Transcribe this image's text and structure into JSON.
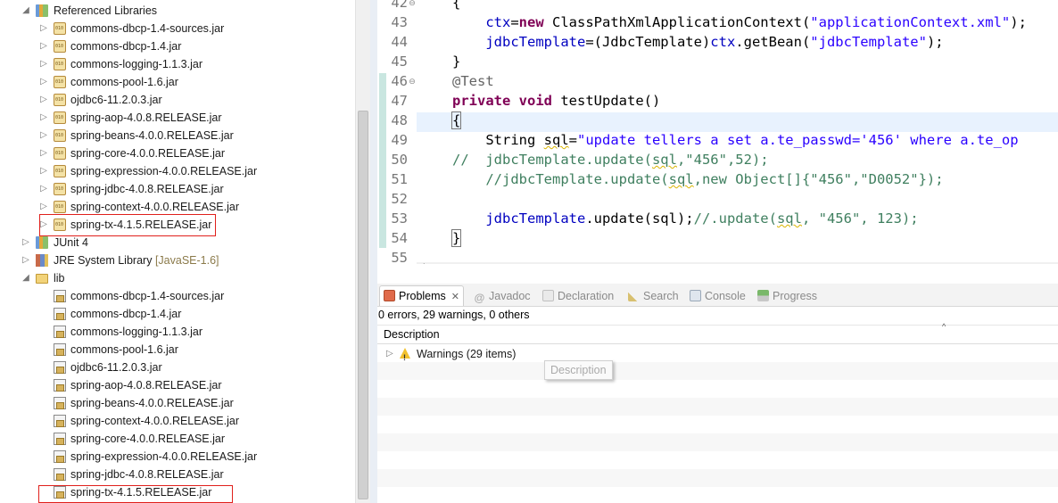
{
  "tree": {
    "referenced_libraries": {
      "label": "Referenced Libraries",
      "items": [
        "commons-dbcp-1.4-sources.jar",
        "commons-dbcp-1.4.jar",
        "commons-logging-1.1.3.jar",
        "commons-pool-1.6.jar",
        "ojdbc6-11.2.0.3.jar",
        "spring-aop-4.0.8.RELEASE.jar",
        "spring-beans-4.0.0.RELEASE.jar",
        "spring-core-4.0.0.RELEASE.jar",
        "spring-expression-4.0.0.RELEASE.jar",
        "spring-jdbc-4.0.8.RELEASE.jar",
        "spring-context-4.0.0.RELEASE.jar",
        "spring-tx-4.1.5.RELEASE.jar"
      ]
    },
    "junit": {
      "label": "JUnit 4"
    },
    "jre": {
      "label": "JRE System Library",
      "suffix": "[JavaSE-1.6]"
    },
    "lib": {
      "label": "lib",
      "items": [
        "commons-dbcp-1.4-sources.jar",
        "commons-dbcp-1.4.jar",
        "commons-logging-1.1.3.jar",
        "commons-pool-1.6.jar",
        "ojdbc6-11.2.0.3.jar",
        "spring-aop-4.0.8.RELEASE.jar",
        "spring-beans-4.0.0.RELEASE.jar",
        "spring-context-4.0.0.RELEASE.jar",
        "spring-core-4.0.0.RELEASE.jar",
        "spring-expression-4.0.0.RELEASE.jar",
        "spring-jdbc-4.0.8.RELEASE.jar",
        "spring-tx-4.1.5.RELEASE.jar"
      ]
    }
  },
  "editor": {
    "line_numbers": [
      "42",
      "43",
      "44",
      "45",
      "46",
      "47",
      "48",
      "49",
      "50",
      "51",
      "52",
      "53",
      "54",
      "55"
    ],
    "code": {
      "l42": "{",
      "l43_indent": "    ",
      "l43_a": "ctx",
      "l43_b": "=",
      "l43_new": "new",
      "l43_c": " ClassPathXmlApplicationContext(",
      "l43_str": "\"applicationContext.xml\"",
      "l43_d": ");",
      "l44_indent": "    ",
      "l44_a": "jdbcTemplate",
      "l44_b": "=(JdbcTemplate)",
      "l44_c": "ctx",
      "l44_d": ".getBean(",
      "l44_str": "\"jdbcTemplate\"",
      "l44_e": ");",
      "l45": "}",
      "l46": "@Test",
      "l47_private": "private",
      "l47_void": "void",
      "l47_rest": " testUpdate()",
      "l48": "{",
      "l49_a": "    String ",
      "l49_var": "sql",
      "l49_b": "=",
      "l49_str": "\"update tellers a set a.te_passwd='456' where a.te_op",
      "l50_cmt_a": "//  jdbcTemplate.update(",
      "l50_sql": "sql",
      "l50_cmt_b": ",\"456\",52);",
      "l51_cmt_a": "    //jdbcTemplate.update(",
      "l51_sql": "sql",
      "l51_cmt_b": ",new Object[]{\"456\",\"D0052\"});",
      "l53_indent": "    ",
      "l53_a": "jdbcTemplate",
      "l53_b": ".update(",
      "l53_c": "sql",
      "l53_d": ");",
      "l53_cmt_a": "//.update(",
      "l53_cmt_sql": "sql",
      "l53_cmt_b": ", \"456\", 123);",
      "l54": "}"
    }
  },
  "problems": {
    "tabs": [
      "Problems",
      "Javadoc",
      "Declaration",
      "Search",
      "Console",
      "Progress"
    ],
    "summary": "0 errors, 29 warnings, 0 others",
    "column": "Description",
    "warnings_row": "Warnings (29 items)",
    "tooltip": "Description"
  },
  "colors": {
    "keyword": "#7f0055",
    "string": "#2a00ff",
    "field": "#0000c0",
    "comment": "#3f7f5f",
    "highlight_box": "#e0201c",
    "current_line": "#e8f2fe"
  }
}
